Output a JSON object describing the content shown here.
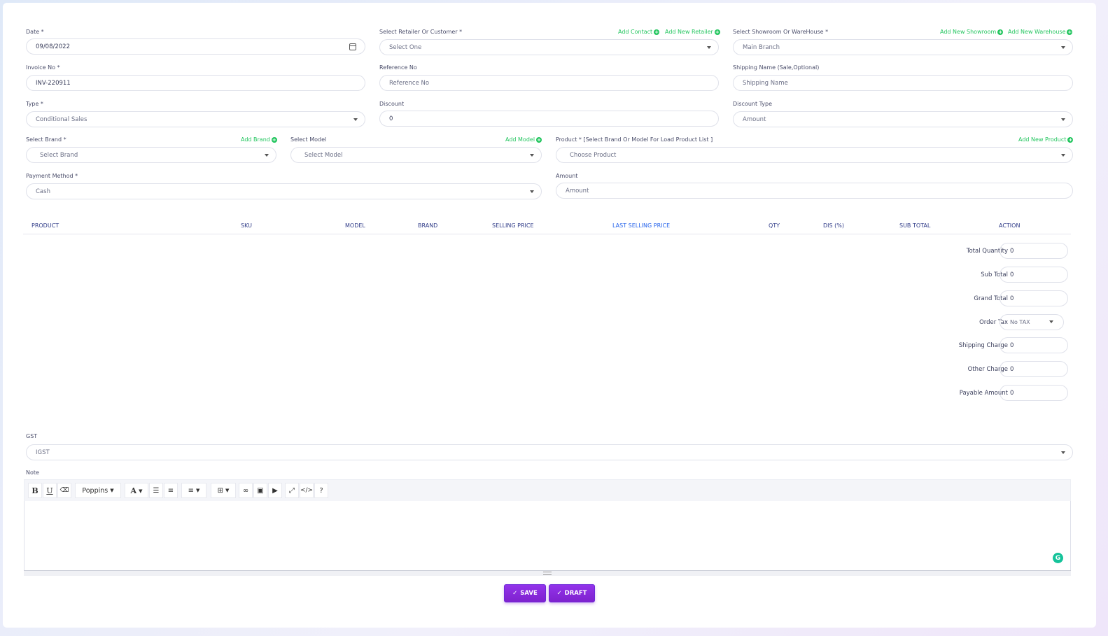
{
  "form": {
    "date": {
      "label": "Date *",
      "value": "09/08/2022"
    },
    "retailer": {
      "label": "Select Retailer Or Customer *",
      "value": "Select One",
      "add_contact": "Add Contact",
      "add_retailer": "Add New Retailer"
    },
    "showroom": {
      "label": "Select Showroom Or WareHouse *",
      "value": "Main Branch",
      "add_showroom": "Add New Showroom",
      "add_warehouse": "Add New Warehouse"
    },
    "invoice": {
      "label": "Invoice No *",
      "value": "INV-220911"
    },
    "reference": {
      "label": "Reference No",
      "placeholder": "Reference No"
    },
    "shipping_name": {
      "label": "Shipping Name (Sale,Optional)",
      "placeholder": "Shipping Name"
    },
    "type": {
      "label": "Type *",
      "value": "Conditional Sales"
    },
    "discount": {
      "label": "Discount",
      "value": "0"
    },
    "discount_type": {
      "label": "Discount Type",
      "value": "Amount"
    },
    "brand": {
      "label": "Select Brand *",
      "value": "Select Brand",
      "add": "Add Brand"
    },
    "model": {
      "label": "Select Model",
      "value": "Select Model",
      "add": "Add Model"
    },
    "product": {
      "label": "Product * [Select Brand Or Model For Load Product List ]",
      "value": "Choose Product",
      "add": "Add New Product"
    },
    "payment": {
      "label": "Payment Method *",
      "value": "Cash"
    },
    "amount": {
      "label": "Amount",
      "placeholder": "Amount"
    }
  },
  "table": {
    "headers": [
      "PRODUCT",
      "SKU",
      "MODEL",
      "BRAND",
      "SELLING PRICE",
      "LAST SELLING PRICE",
      "QTY",
      "DIS (%)",
      "SUB TOTAL",
      "ACTION"
    ]
  },
  "summary": {
    "total_quantity": {
      "label": "Total Quantity",
      "value": "0"
    },
    "sub_total": {
      "label": "Sub Total",
      "value": "0"
    },
    "grand_total": {
      "label": "Grand Total",
      "value": "0"
    },
    "order_tax": {
      "label": "Order Tax",
      "value": "No TAX"
    },
    "shipping_charge": {
      "label": "Shipping Charge",
      "value": "0"
    },
    "other_charge": {
      "label": "Other Charge",
      "value": "0"
    },
    "payable_amount": {
      "label": "Payable Amount",
      "value": "0"
    }
  },
  "gst": {
    "label": "GST",
    "value": "IGST"
  },
  "note": {
    "label": "Note",
    "toolbar": {
      "bold": "B",
      "underline": "U",
      "font": "Poppins",
      "color": "A",
      "code": "</>",
      "help": "?"
    }
  },
  "buttons": {
    "save": "SAVE",
    "draft": "DRAFT"
  },
  "colors": {
    "accent": "#7e22ce",
    "add_link": "#22c55e",
    "header_text": "#2e3a87"
  }
}
